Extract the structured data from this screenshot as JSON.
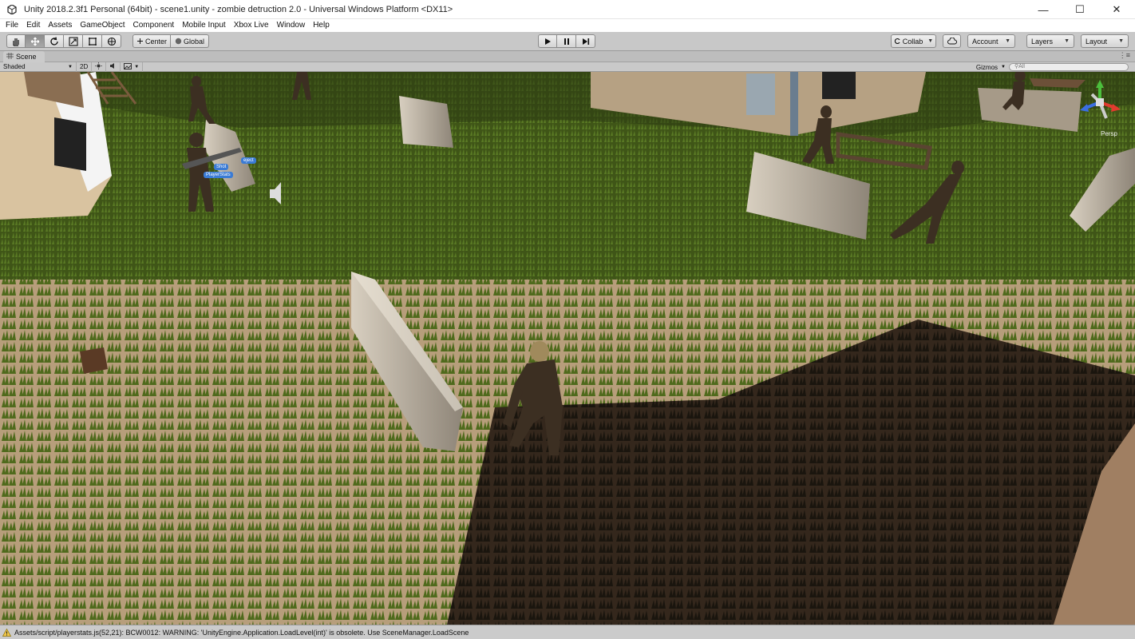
{
  "window": {
    "title": "Unity 2018.2.3f1 Personal (64bit) - scene1.unity - zombie detruction 2.0 - Universal Windows Platform <DX11>",
    "controls": {
      "minimize": "—",
      "maximize": "☐",
      "close": "✕"
    }
  },
  "menu": [
    "File",
    "Edit",
    "Assets",
    "GameObject",
    "Component",
    "Mobile Input",
    "Xbox Live",
    "Window",
    "Help"
  ],
  "toolbar": {
    "tools": [
      {
        "name": "hand-tool",
        "icon": "hand-icon"
      },
      {
        "name": "move-tool",
        "icon": "move-arrows-icon",
        "active": true
      },
      {
        "name": "rotate-tool",
        "icon": "rotate-icon"
      },
      {
        "name": "scale-tool",
        "icon": "scale-icon"
      },
      {
        "name": "rect-tool",
        "icon": "rect-icon"
      },
      {
        "name": "transform-tool",
        "icon": "transform-icon"
      }
    ],
    "pivot_label": "Center",
    "space_label": "Global",
    "play": {
      "play_icon": "play-icon",
      "pause_icon": "pause-icon",
      "step_icon": "step-icon"
    },
    "collab_label": "Collab",
    "account_label": "Account",
    "layers_label": "Layers",
    "layout_label": "Layout"
  },
  "scene_tab": {
    "label": "Scene",
    "icon": "scene-grid-icon",
    "menu": "⋮≡"
  },
  "scene_toolbar": {
    "draw_mode": "Shaded",
    "mode_2d": "2D",
    "gizmos_label": "Gizmos",
    "search_placeholder": "All"
  },
  "scene": {
    "labels": [
      "Shot",
      "PlayerStats",
      "eject"
    ],
    "projection_label": "Persp"
  },
  "status": {
    "message": "Assets/script/playerstats.js(52,21): BCW0012: WARNING: 'UnityEngine.Application.LoadLevel(int)' is obsolete. Use SceneManager.LoadScene",
    "colors": {
      "warning": "#f2c94c"
    }
  }
}
